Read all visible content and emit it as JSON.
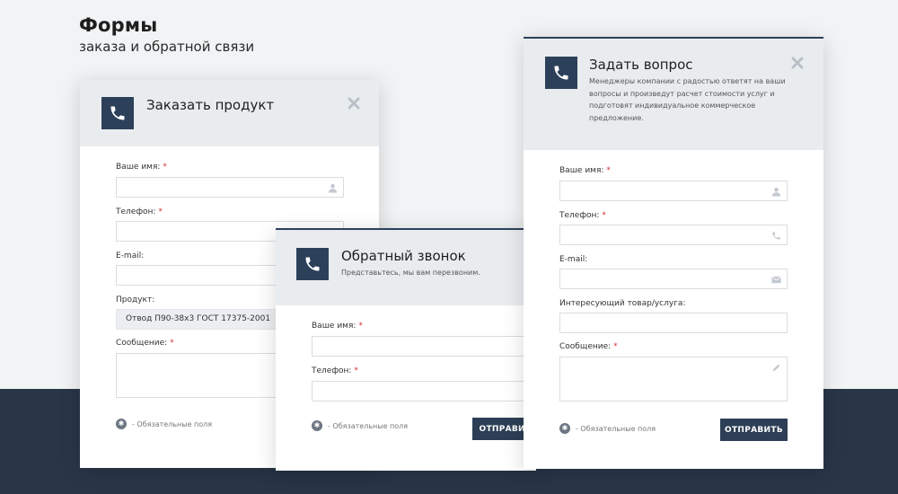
{
  "page": {
    "title": "Формы",
    "subtitle": "заказа и обратной связи"
  },
  "icons": {
    "phone": "phone-icon",
    "close": "close-icon",
    "user": "user-icon",
    "phone_small": "phone-small-icon",
    "email": "envelope-icon",
    "pencil": "pencil-icon",
    "star": "asterisk-icon"
  },
  "colors": {
    "accent": "#2c405a",
    "band": "#293648",
    "required": "#d0302f",
    "header_bg": "#e9ecef"
  },
  "order_form": {
    "title": "Заказать продукт",
    "name_label": "Ваше имя:",
    "phone_label": "Телефон:",
    "email_label": "E-mail:",
    "product_label": "Продукт:",
    "product_value": "Отвод П90-38x3 ГОСТ 17375-2001",
    "message_label": "Сообщение:",
    "required_note": "- Обязательные поля",
    "required_mark": "*"
  },
  "callback_form": {
    "title": "Обратный звонок",
    "description": "Представьтесь, мы вам перезвоним.",
    "name_label": "Ваше имя:",
    "phone_label": "Телефон:",
    "required_note": "- Обязательные поля",
    "submit_label": "ОТПРАВИТЬ",
    "required_mark": "*"
  },
  "question_form": {
    "title": "Задать вопрос",
    "description": "Менеджеры компании с радостью ответят на ваши вопросы и произведут расчет стоимости услуг и подготовят индивидуальное коммерческое предложение.",
    "name_label": "Ваше имя:",
    "phone_label": "Телефон:",
    "email_label": "E-mail:",
    "interest_label": "Интересующий товар/услуга:",
    "message_label": "Сообщение:",
    "required_note": "- Обязательные поля",
    "submit_label": "ОТПРАВИТЬ",
    "required_mark": "*"
  }
}
